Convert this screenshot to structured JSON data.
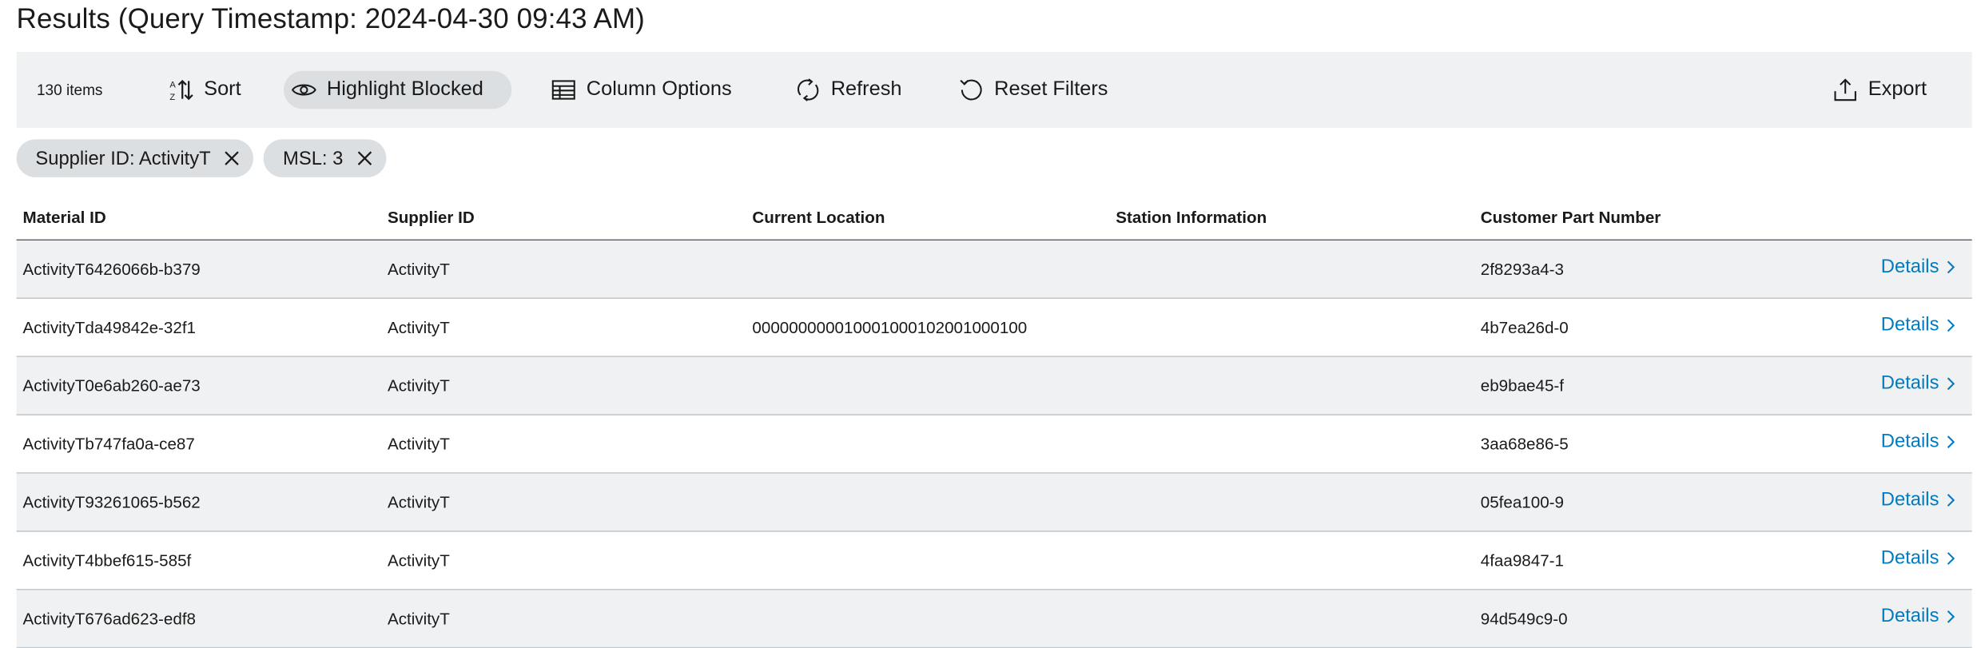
{
  "page": {
    "title": "Results (Query Timestamp: 2024-04-30 09:43 AM)"
  },
  "toolbar": {
    "item_count": "130 items",
    "sort_label": "Sort",
    "highlight_label": "Highlight Blocked",
    "column_options_label": "Column Options",
    "refresh_label": "Refresh",
    "reset_filters_label": "Reset Filters",
    "export_label": "Export"
  },
  "filters": [
    {
      "label": "Supplier ID: ActivityT"
    },
    {
      "label": "MSL: 3"
    }
  ],
  "table": {
    "columns": [
      "Material ID",
      "Supplier ID",
      "Current Location",
      "Station Information",
      "Customer Part Number"
    ],
    "details_label": "Details",
    "rows": [
      {
        "material_id": "ActivityT6426066b-b379",
        "supplier_id": "ActivityT",
        "current_location": "",
        "station_information": "",
        "customer_part_number": "2f8293a4-3"
      },
      {
        "material_id": "ActivityTda49842e-32f1",
        "supplier_id": "ActivityT",
        "current_location": "000000000010001000102001000100",
        "station_information": "",
        "customer_part_number": "4b7ea26d-0"
      },
      {
        "material_id": "ActivityT0e6ab260-ae73",
        "supplier_id": "ActivityT",
        "current_location": "",
        "station_information": "",
        "customer_part_number": "eb9bae45-f"
      },
      {
        "material_id": "ActivityTb747fa0a-ce87",
        "supplier_id": "ActivityT",
        "current_location": "",
        "station_information": "",
        "customer_part_number": "3aa68e86-5"
      },
      {
        "material_id": "ActivityT93261065-b562",
        "supplier_id": "ActivityT",
        "current_location": "",
        "station_information": "",
        "customer_part_number": "05fea100-9"
      },
      {
        "material_id": "ActivityT4bbef615-585f",
        "supplier_id": "ActivityT",
        "current_location": "",
        "station_information": "",
        "customer_part_number": "4faa9847-1"
      },
      {
        "material_id": "ActivityT676ad623-edf8",
        "supplier_id": "ActivityT",
        "current_location": "",
        "station_information": "",
        "customer_part_number": "94d549c9-0"
      }
    ]
  },
  "icons": {
    "sort": "sort-icon",
    "highlight": "eye-icon",
    "column_options": "table-icon",
    "refresh": "refresh-icon",
    "reset_filters": "reset-icon",
    "export": "export-icon",
    "chip_remove": "close-icon",
    "details": "chevron-right-icon"
  },
  "colors": {
    "accent": "#007bc0",
    "toolbar_bg": "#eff1f2",
    "chip_bg": "#dcdfe1"
  }
}
